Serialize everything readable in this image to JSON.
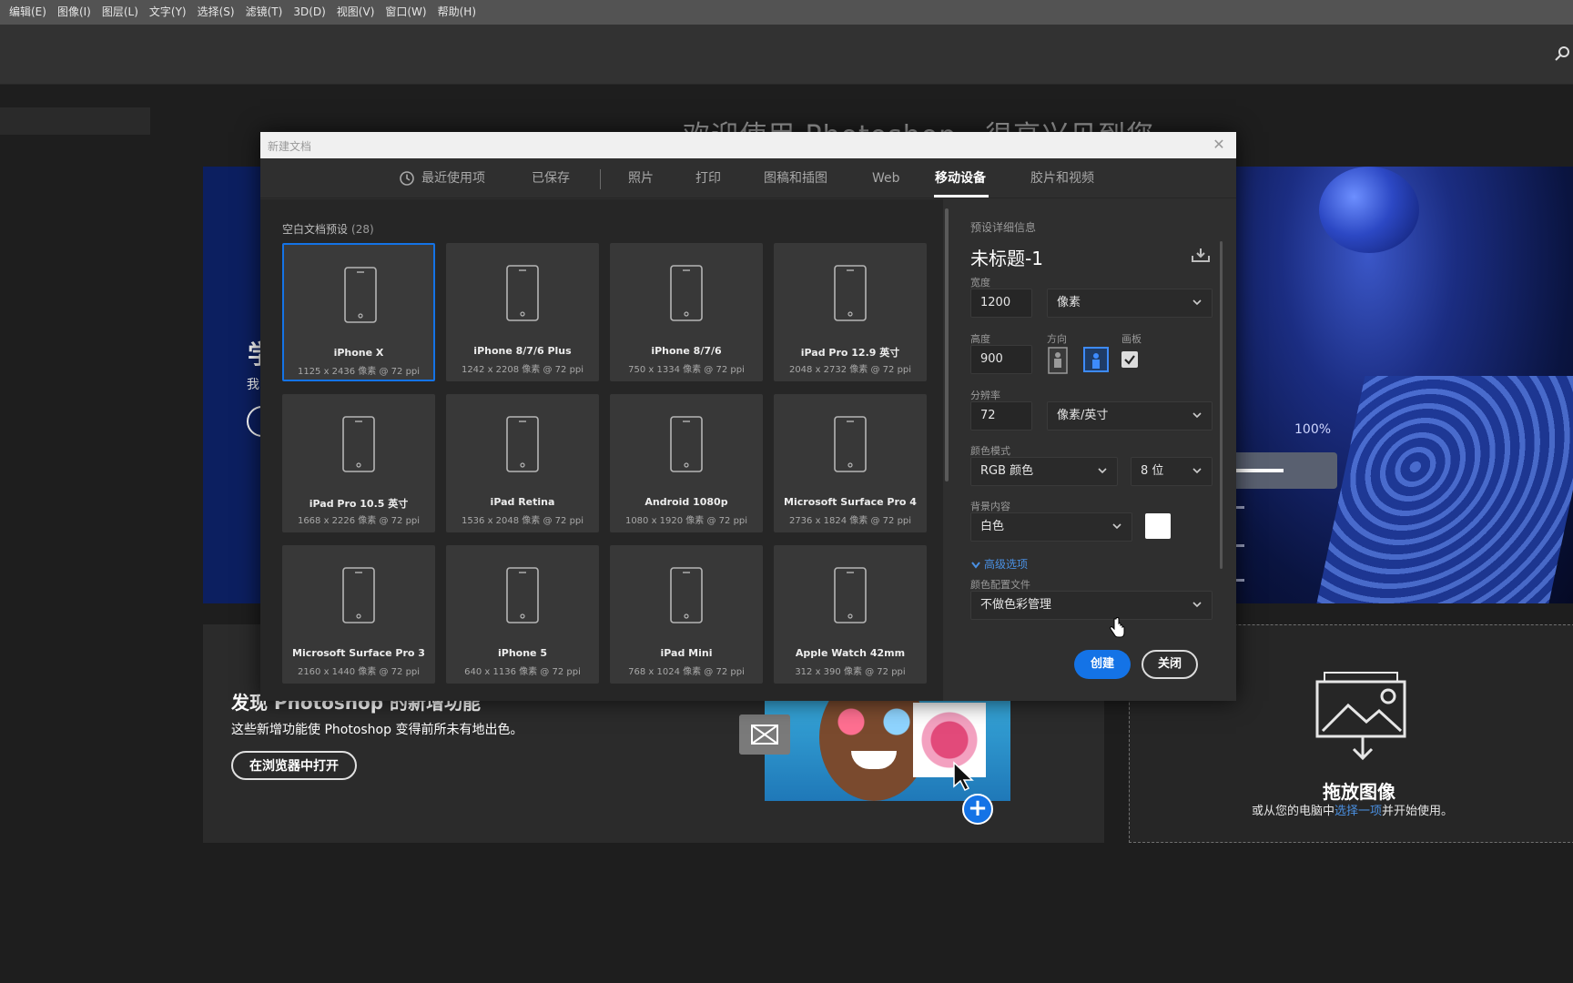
{
  "menubar": {
    "items": [
      "编辑(E)",
      "图像(I)",
      "图层(L)",
      "文字(Y)",
      "选择(S)",
      "滤镜(T)",
      "3D(D)",
      "视图(V)",
      "窗口(W)",
      "帮助(H)"
    ]
  },
  "start": {
    "welcome": "欢迎使用 Photoshop，很高兴见到您",
    "hero_learn": "学",
    "hero_sub": "我",
    "hero_percent": "100%",
    "discover_title": "发现 Photoshop 的新增功能",
    "discover_desc": "这些新增功能使 Photoshop 变得前所未有地出色。",
    "discover_button": "在浏览器中打开",
    "drop_title": "拖放图像",
    "drop_desc_pre": "或从您的电脑中",
    "drop_desc_link": "选择一项",
    "drop_desc_post": "并开始使用。"
  },
  "dialog": {
    "title": "新建文档",
    "tabs": [
      "最近使用项",
      "已保存",
      "照片",
      "打印",
      "图稿和插图",
      "Web",
      "移动设备",
      "胶片和视频"
    ],
    "active_tab": "移动设备",
    "presets_label": "空白文档预设",
    "presets_count": "(28)",
    "presets": [
      {
        "name": "iPhone X",
        "size": "1125 x 2436 像素 @ 72 ppi",
        "selected": true
      },
      {
        "name": "iPhone 8/7/6 Plus",
        "size": "1242 x 2208 像素 @ 72 ppi"
      },
      {
        "name": "iPhone 8/7/6",
        "size": "750 x 1334 像素 @ 72 ppi"
      },
      {
        "name": "iPad Pro 12.9 英寸",
        "size": "2048 x 2732 像素 @ 72 ppi"
      },
      {
        "name": "iPad Pro 10.5 英寸",
        "size": "1668 x 2226 像素 @ 72 ppi"
      },
      {
        "name": "iPad Retina",
        "size": "1536 x 2048 像素 @ 72 ppi"
      },
      {
        "name": "Android 1080p",
        "size": "1080 x 1920 像素 @ 72 ppi"
      },
      {
        "name": "Microsoft Surface Pro 4",
        "size": "2736 x 1824 像素 @ 72 ppi"
      },
      {
        "name": "Microsoft Surface Pro 3",
        "size": "2160 x 1440 像素 @ 72 ppi"
      },
      {
        "name": "iPhone 5",
        "size": "640 x 1136 像素 @ 72 ppi"
      },
      {
        "name": "iPad Mini",
        "size": "768 x 1024 像素 @ 72 ppi"
      },
      {
        "name": "Apple Watch 42mm",
        "size": "312 x 390 像素 @ 72 ppi"
      }
    ],
    "details": {
      "header": "预设详细信息",
      "doc_name": "未标题-1",
      "width_label": "宽度",
      "width_value": "1200",
      "width_unit": "像素",
      "height_label": "高度",
      "height_value": "900",
      "orientation_label": "方向",
      "artboard_label": "画板",
      "resolution_label": "分辨率",
      "resolution_value": "72",
      "resolution_unit": "像素/英寸",
      "color_mode_label": "颜色模式",
      "color_mode_value": "RGB 颜色",
      "bit_depth": "8 位",
      "bg_label": "背景内容",
      "bg_value": "白色",
      "advanced_label": "高级选项",
      "profile_label": "颜色配置文件",
      "profile_value": "不做色彩管理",
      "create_button": "创建",
      "close_button": "关闭"
    }
  },
  "colors": {
    "accent": "#1473e6",
    "link": "#4a90e2"
  }
}
